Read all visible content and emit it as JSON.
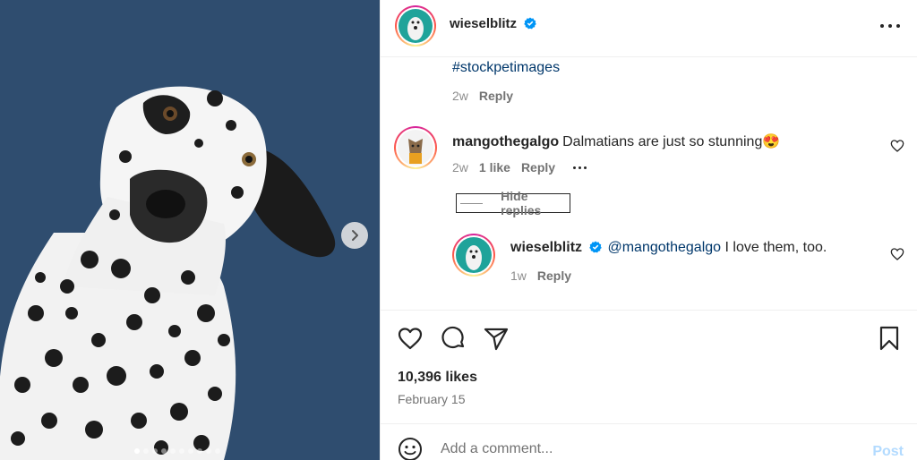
{
  "post": {
    "author": "wieselblitz",
    "caption_tail": "#stockpetimages",
    "caption_age": "2w",
    "reply_label": "Reply"
  },
  "comments": [
    {
      "user": "mangothegalgo",
      "text": "Dalmatians are just so stunning",
      "emoji": "😍",
      "age": "2w",
      "likes": "1 like",
      "reply_label": "Reply",
      "hide_replies_label": "Hide replies",
      "replies": [
        {
          "user": "wieselblitz",
          "mention": "@mangothegalgo",
          "text": "I love them, too.",
          "age": "1w",
          "reply_label": "Reply"
        }
      ]
    }
  ],
  "engagement": {
    "likes": "10,396 likes",
    "date": "February 15"
  },
  "composer": {
    "placeholder": "Add a comment...",
    "post_label": "Post"
  },
  "carousel": {
    "slides": 10,
    "active": 1
  },
  "icons": {
    "verified": "verified-badge-icon",
    "more": "more-horizontal-icon",
    "like": "heart-icon",
    "comment": "comment-icon",
    "share": "share-icon",
    "save": "bookmark-icon",
    "emoji": "emoji-icon",
    "next": "chevron-right-icon"
  },
  "colors": {
    "verified": "#0095f6",
    "link": "#00376b",
    "muted": "#737373",
    "post_disabled": "#b3dbff",
    "media_bg": "#2f4d6f"
  }
}
